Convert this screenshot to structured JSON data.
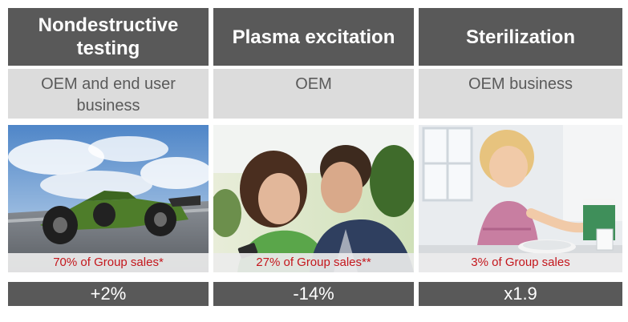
{
  "columns": [
    {
      "title": "Nondestructive testing",
      "business": "OEM and end user business",
      "sales_share": "70% of Group sales*",
      "change": "+2%",
      "image_icon": "race-car-image"
    },
    {
      "title": "Plasma excitation",
      "business": "OEM",
      "sales_share": "27% of Group sales**",
      "change": "-14%",
      "image_icon": "couple-smartphone-image"
    },
    {
      "title": "Sterilization",
      "business": "OEM business",
      "sales_share": "3% of Group sales",
      "change": "x1.9",
      "image_icon": "child-kitchen-image"
    }
  ],
  "colors": {
    "header_bg": "#595959",
    "subheader_bg": "#dcdcdc",
    "caption_text": "#c4161c"
  }
}
